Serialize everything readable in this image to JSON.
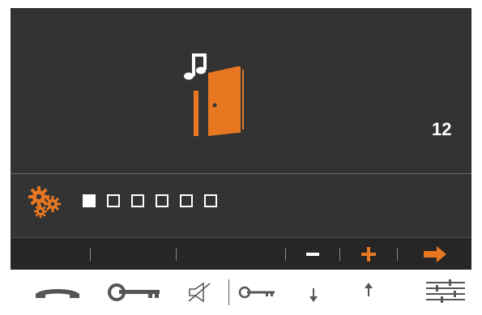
{
  "display": {
    "value": "12",
    "main_icon": "music-door-icon",
    "settings_icon": "gears-icon",
    "level": {
      "selected": 1,
      "total": 6
    }
  },
  "softkeys": [
    {
      "icon": "none"
    },
    {
      "icon": "none"
    },
    {
      "icon": "none"
    },
    {
      "icon": "minus-icon"
    },
    {
      "icon": "plus-icon"
    },
    {
      "icon": "arrow-right-icon"
    }
  ],
  "hardkeys": [
    {
      "icon": "handset-icon"
    },
    {
      "icon": "key-icon"
    },
    {
      "icon": "mute-icon"
    },
    {
      "icon": "key-small-icon"
    },
    {
      "icon": "arrow-down-icon"
    },
    {
      "icon": "arrow-up-icon"
    },
    {
      "icon": "menu-icon"
    }
  ],
  "colors": {
    "accent": "#e87722",
    "screen": "#333333",
    "text": "#ffffff",
    "key_icons": "#555555"
  }
}
